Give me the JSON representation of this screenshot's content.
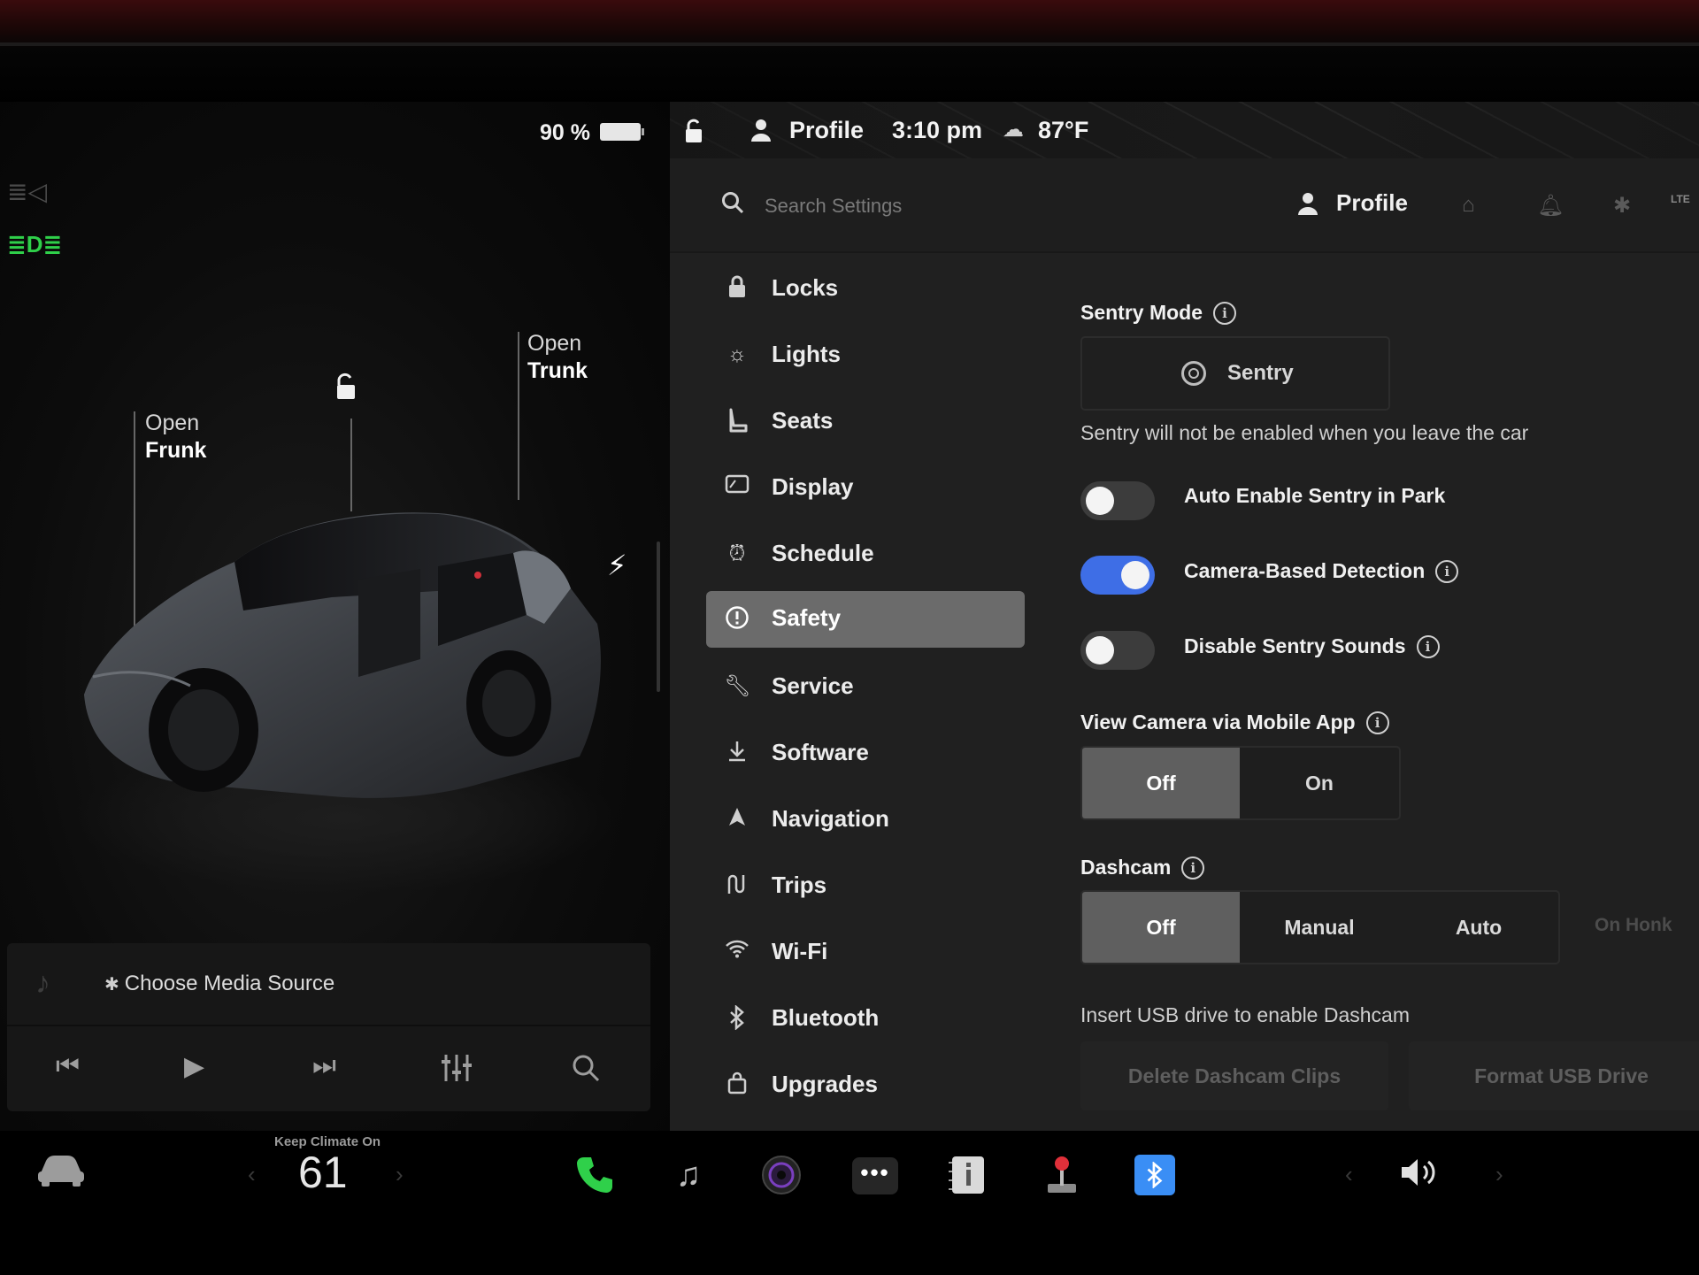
{
  "status": {
    "battery_pct": "90 %",
    "profile": "Profile",
    "time": "3:10 pm",
    "temperature": "87°F"
  },
  "car_panel": {
    "frunk_line1": "Open",
    "frunk_line2": "Frunk",
    "trunk_line1": "Open",
    "trunk_line2": "Trunk"
  },
  "media": {
    "source": "Choose Media Source",
    "bluetooth_glyph": "✱"
  },
  "header": {
    "search_placeholder": "Search Settings",
    "profile": "Profile"
  },
  "nav": {
    "items": [
      {
        "label": "Locks",
        "icon": "lock-icon"
      },
      {
        "label": "Lights",
        "icon": "sun-icon"
      },
      {
        "label": "Seats",
        "icon": "seat-icon"
      },
      {
        "label": "Display",
        "icon": "display-icon"
      },
      {
        "label": "Schedule",
        "icon": "alarm-clock-icon"
      },
      {
        "label": "Safety",
        "icon": "alert-circle-icon",
        "active": true
      },
      {
        "label": "Service",
        "icon": "wrench-icon"
      },
      {
        "label": "Software",
        "icon": "download-icon"
      },
      {
        "label": "Navigation",
        "icon": "navigation-arrow-icon"
      },
      {
        "label": "Trips",
        "icon": "trips-icon"
      },
      {
        "label": "Wi-Fi",
        "icon": "wifi-icon"
      },
      {
        "label": "Bluetooth",
        "icon": "bluetooth-icon"
      },
      {
        "label": "Upgrades",
        "icon": "shopping-bag-icon"
      }
    ]
  },
  "safety": {
    "sentry_title": "Sentry Mode",
    "sentry_button": "Sentry",
    "sentry_note": "Sentry will not be enabled when you leave the car",
    "toggles": [
      {
        "label": "Auto Enable Sentry in Park",
        "on": false
      },
      {
        "label": "Camera-Based Detection",
        "on": true
      },
      {
        "label": "Disable Sentry Sounds",
        "on": false
      }
    ],
    "view_camera_title": "View Camera via Mobile App",
    "view_camera_options": [
      "Off",
      "On"
    ],
    "view_camera_selected": "Off",
    "dashcam_title": "Dashcam",
    "dashcam_options": [
      "Off",
      "Manual",
      "Auto",
      "On Honk"
    ],
    "dashcam_selected": "Off",
    "dashcam_note": "Insert USB drive to enable Dashcam",
    "delete_clips": "Delete Dashcam Clips",
    "format_usb": "Format USB Drive"
  },
  "taskbar": {
    "keep_climate": "Keep Climate On",
    "temperature": "61"
  },
  "colors": {
    "toggle_on": "#3e6ee6",
    "phone_green": "#2fd04a",
    "bluetooth_tile": "#3a8ef5",
    "selected_nav": "#6b6b6b"
  }
}
